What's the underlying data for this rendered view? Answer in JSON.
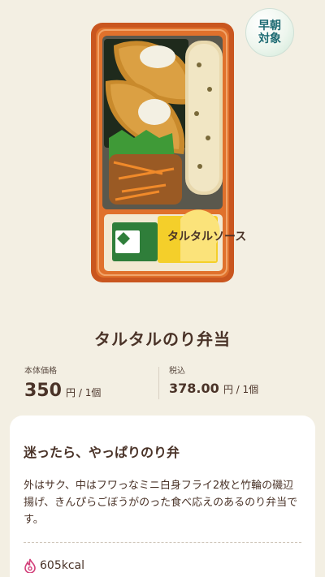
{
  "product": {
    "title": "タルタルのり弁当",
    "badge": "早朝対象",
    "image_alt": "タルタルのり弁当の商品写真",
    "sauce_packet_text": "タルタルソース"
  },
  "prices": {
    "base": {
      "label": "本体価格",
      "amount": "350",
      "unit": "円 / 1個"
    },
    "tax_included": {
      "label": "税込",
      "amount": "378.00",
      "unit": "円 / 1個"
    }
  },
  "description": {
    "headline": "迷ったら、やっぱりのり弁",
    "body": "外はサク、中はフワっなミニ白身フライ2枚と竹輪の磯辺揚げ、きんぴらごぼうがのった食べ応えのあるのり弁当です。",
    "calories": "605kcal"
  },
  "colors": {
    "background": "#f3efe3",
    "text": "#4a3328",
    "badge_text": "#1e6b73",
    "flame_icon": "#d2407a"
  }
}
